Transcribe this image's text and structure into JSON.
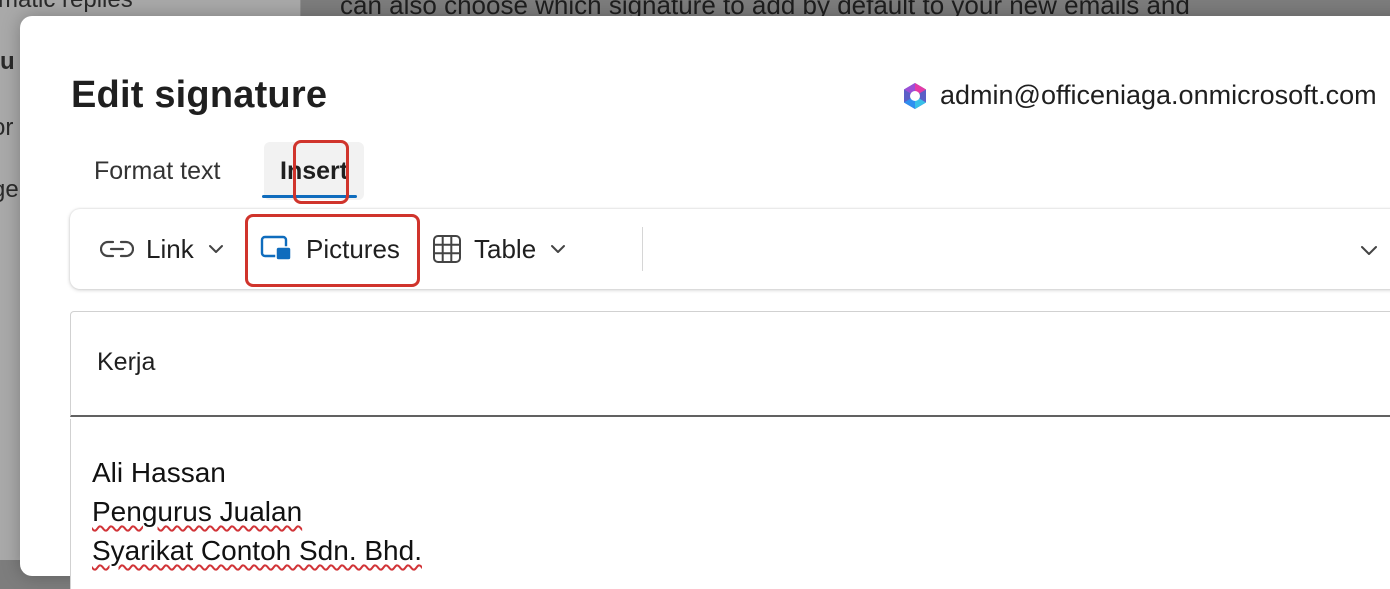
{
  "background": {
    "sidebar_items": [
      "matic replies",
      "tu",
      "or",
      "ge"
    ],
    "main_text": "can also choose which signature to add by default to your new emails and"
  },
  "dialog": {
    "title": "Edit signature",
    "account_email": "admin@officeniaga.onmicrosoft.com",
    "tabs": [
      {
        "label": "Format text",
        "selected": false
      },
      {
        "label": "Insert",
        "selected": true
      }
    ],
    "toolbar": {
      "link_label": "Link",
      "pictures_label": "Pictures",
      "table_label": "Table"
    },
    "signature_name": "Kerja",
    "signature_lines": [
      "Ali Hassan",
      "Pengurus Jualan",
      "Syarikat Contoh Sdn. Bhd."
    ]
  },
  "colors": {
    "accent": "#0f6cbd",
    "highlight_box": "#d0342c",
    "spellcheck": "#d13438"
  },
  "icons": [
    "copilot-logo-icon",
    "link-icon",
    "pictures-icon",
    "table-icon",
    "chevron-down-icon"
  ]
}
